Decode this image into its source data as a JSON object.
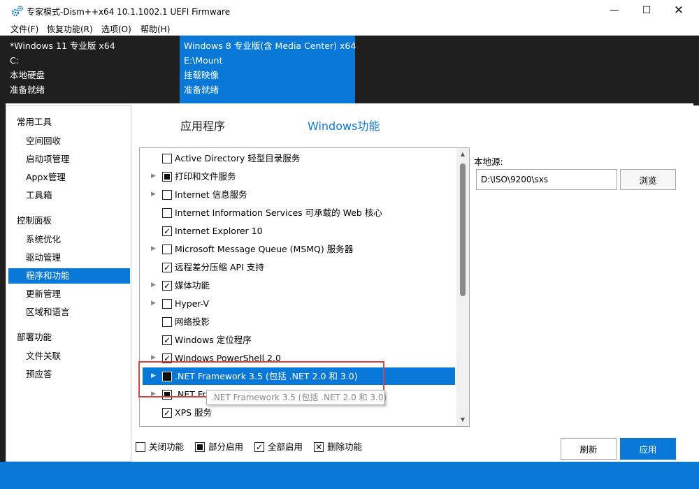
{
  "window": {
    "title": "专家模式-Dism++x64 10.1.1002.1 UEFI Firmware",
    "minimize_icon": "minimize-icon",
    "maximize_icon": "maximize-icon",
    "close_icon": "close-icon"
  },
  "menu": [
    "文件(F)",
    "恢复功能(R)",
    "选项(O)",
    "帮助(H)"
  ],
  "images": [
    {
      "name": "*Windows 11 专业版 x64",
      "drive": "C:",
      "type": "本地硬盘",
      "status": "准备就绪",
      "selected": false
    },
    {
      "name": "Windows 8 专业版(含 Media Center) x64",
      "drive": "E:\\Mount",
      "type": "挂载映像",
      "status": "准备就绪",
      "selected": true
    }
  ],
  "nav": {
    "groups": [
      {
        "label": "常用工具",
        "items": [
          "空间回收",
          "启动项管理",
          "Appx管理",
          "工具箱"
        ]
      },
      {
        "label": "控制面板",
        "items": [
          "系统优化",
          "驱动管理",
          "程序和功能",
          "更新管理",
          "区域和语言"
        ]
      },
      {
        "label": "部署功能",
        "items": [
          "文件关联",
          "预应答"
        ]
      }
    ],
    "selected": "程序和功能"
  },
  "tabs": [
    "应用程序",
    "Windows功能"
  ],
  "active_tab": "Windows功能",
  "features": [
    {
      "label": "Active Directory 轻型目录服务",
      "state": "unchecked",
      "expandable": false
    },
    {
      "label": "打印和文件服务",
      "state": "partial",
      "expandable": true
    },
    {
      "label": "Internet 信息服务",
      "state": "unchecked",
      "expandable": true
    },
    {
      "label": "Internet Information Services 可承载的 Web 核心",
      "state": "unchecked",
      "expandable": false
    },
    {
      "label": "Internet Explorer 10",
      "state": "checked",
      "expandable": false
    },
    {
      "label": "Microsoft Message Queue (MSMQ) 服务器",
      "state": "unchecked",
      "expandable": true
    },
    {
      "label": "远程差分压缩 API 支持",
      "state": "checked",
      "expandable": false
    },
    {
      "label": "媒体功能",
      "state": "checked",
      "expandable": true
    },
    {
      "label": "Hyper-V",
      "state": "unchecked",
      "expandable": true
    },
    {
      "label": "网络投影",
      "state": "unchecked",
      "expandable": false
    },
    {
      "label": "Windows 定位程序",
      "state": "checked",
      "expandable": false
    },
    {
      "label": "Windows PowerShell 2.0",
      "state": "checked",
      "expandable": true
    },
    {
      "label": ".NET Framework 3.5 (包括 .NET 2.0 和 3.0)",
      "state": "partial",
      "expandable": true,
      "selected": true
    },
    {
      "label": ".NET Fra",
      "state": "partial",
      "expandable": true
    },
    {
      "label": "XPS 服务",
      "state": "checked",
      "expandable": false
    }
  ],
  "tooltip": ".NET Framework 3.5 (包括 .NET 2.0 和 3.0)",
  "source": {
    "label": "本地源:",
    "value": "D:\\ISO\\9200\\sxs",
    "browse_label": "浏览"
  },
  "legend": [
    {
      "label": "关闭功能",
      "state": "unchecked"
    },
    {
      "label": "部分启用",
      "state": "partial"
    },
    {
      "label": "全部启用",
      "state": "checked"
    },
    {
      "label": "删除功能",
      "state": "deleted"
    }
  ],
  "buttons": {
    "refresh": "刷新",
    "apply": "应用"
  },
  "colors": {
    "accent": "#0a78d7",
    "dark": "#1f1f1f",
    "highlight": "#e0403c"
  }
}
